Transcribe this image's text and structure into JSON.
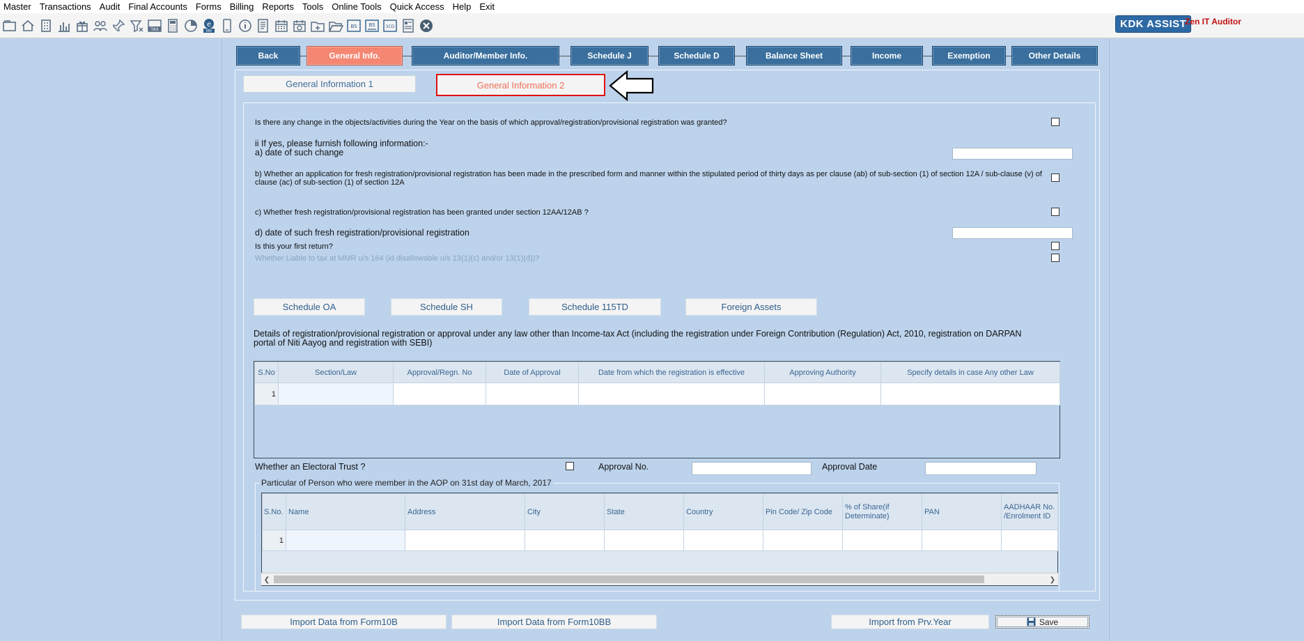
{
  "menu": [
    "Master",
    "Transactions",
    "Audit",
    "Final Accounts",
    "Forms",
    "Billing",
    "Reports",
    "Tools",
    "Online Tools",
    "Quick Access",
    "Help",
    "Exit"
  ],
  "toolbar_icons": [
    "folder-icon",
    "home-icon",
    "building-icon",
    "bar-chart-icon",
    "gift-icon",
    "users-icon",
    "pin-icon",
    "filter-icon",
    "tax-icon",
    "calculator-icon",
    "pie-chart-icon",
    "epay-icon",
    "tablet-icon",
    "info-icon",
    "document-icon",
    "calendar-icon",
    "calendar2-icon",
    "folder-add-icon",
    "folder-open-icon",
    "bs-icon",
    "bs2-icon",
    "3cd-icon",
    "form-icon",
    "close-icon"
  ],
  "brand": {
    "name": "KDK ASSIST",
    "product": "Zen IT Auditor"
  },
  "tabs": [
    "Back",
    "General Info.",
    "Auditor/Member Info.",
    "Schedule J",
    "Schedule D",
    "Balance Sheet",
    "Income",
    "Exemption",
    "Other Details"
  ],
  "subtabs": [
    "General Information 1",
    "General Information 2"
  ],
  "questions": {
    "q1": "Is there any change in the objects/activities during the Year on the basis of which approval/registration/provisional registration was granted?",
    "ii": "ii If yes, please furnish following information:-",
    "a": "a) date of such change",
    "b1": "b) Whether an application for fresh registration/provisional registration has been made in the prescribed form and manner within the stipulated period of thirty days as per clause (ab) of sub-section (1) of section 12A / sub-clause (v) of",
    "b2": "clause (ac) of sub-section (1) of section 12A",
    "c": "c) Whether fresh registration/provisional registration has been granted under section 12AA/12AB ?",
    "d": "d) date of such fresh registration/provisional registration",
    "first": "Is this your first return?",
    "mmr": "Whether Liable to tax at MMR u/s 164 (id disallowable u/s 13(1)(c) and/or 13(1)(d))?"
  },
  "schedule_buttons": [
    "Schedule OA",
    "Schedule SH",
    "Schedule 115TD",
    "Foreign Assets"
  ],
  "details_text1": "Details of registration/provisional registration or approval under any law other than Income-tax Act (including the registration under Foreign Contribution (Regulation) Act, 2010, registration on DARPAN",
  "details_text2": "portal of Niti Aayog and registration with SEBI)",
  "reg_table": {
    "headers": [
      "S.No",
      "Section/Law",
      "Approval/Regn. No",
      "Date of Approval",
      "Date from which the registration is effective",
      "Approving Authority",
      "Specify details in case Any other Law"
    ],
    "rows": [
      [
        "1",
        "",
        "",
        "",
        "",
        "",
        ""
      ]
    ]
  },
  "electoral": {
    "label": "Whether an Electoral Trust ?",
    "approval_no": "Approval No.",
    "approval_date": "Approval Date"
  },
  "aop_group": "Particular of Person who were member in the AOP on 31st day of March, 2017",
  "aop_table": {
    "headers": [
      "S.No.",
      "Name",
      "Address",
      "City",
      "State",
      "Country",
      "Pin Code/ Zip Code",
      "% of Share(if Determinate)",
      "PAN",
      "AADHAAR No. /Enrolment ID"
    ],
    "rows": [
      [
        "1",
        "",
        "",
        "",
        "",
        "",
        "",
        "",
        "",
        ""
      ]
    ]
  },
  "bottom_buttons": {
    "import10b": "Import Data from Form10B",
    "import10bb": "Import Data from Form10BB",
    "import_prv": "Import from Prv.Year",
    "save": "Save"
  }
}
